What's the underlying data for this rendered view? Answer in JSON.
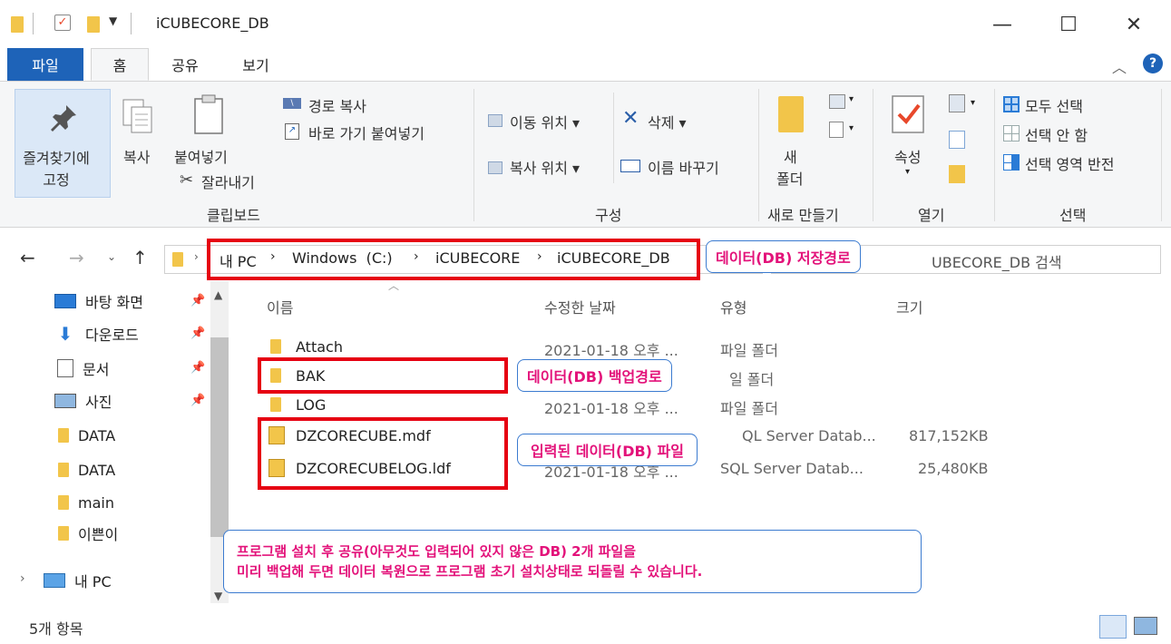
{
  "window": {
    "title": "iCUBECORE_DB",
    "minimize": "—",
    "maximize": "☐",
    "close": "✕"
  },
  "tabs": {
    "file": "파일",
    "home": "홈",
    "share": "공유",
    "view": "보기"
  },
  "ribbon": {
    "pin_line1": "즐겨찾기에",
    "pin_line2": "고정",
    "copy": "복사",
    "paste": "붙여넣기",
    "copy_path": "경로 복사",
    "paste_shortcut": "바로 가기 붙여넣기",
    "cut": "잘라내기",
    "group_clipboard": "클립보드",
    "move_to": "이동 위치 ▾",
    "copy_to": "복사 위치 ▾",
    "delete": "삭제 ▾",
    "rename": "이름 바꾸기",
    "group_organize": "구성",
    "new_folder_line1": "새",
    "new_folder_line2": "폴더",
    "group_new": "새로 만들기",
    "properties": "속성",
    "group_open": "열기",
    "select_all": "모두 선택",
    "select_none": "선택 안 함",
    "invert_selection": "선택 영역 반전",
    "group_select": "선택"
  },
  "address": {
    "crumbs": [
      "내 PC",
      "Windows  (C:)",
      "iCUBECORE",
      "iCUBECORE_DB"
    ],
    "search_placeholder": "iCUBECORE_DB 검색",
    "search_visible": "UBECORE_DB 검색"
  },
  "sidebar": {
    "items": [
      {
        "label": "바탕 화면",
        "pinned": true
      },
      {
        "label": "다운로드",
        "pinned": true
      },
      {
        "label": "문서",
        "pinned": true
      },
      {
        "label": "사진",
        "pinned": true
      },
      {
        "label": "DATA"
      },
      {
        "label": "DATA"
      },
      {
        "label": "main"
      },
      {
        "label": "이쁜이"
      },
      {
        "label": "내 PC"
      }
    ]
  },
  "columns": {
    "name": "이름",
    "modified": "수정한 날짜",
    "type": "유형",
    "size": "크기"
  },
  "files": [
    {
      "name": "Attach",
      "modified": "2021-01-18 오후 ...",
      "type": "파일 폴더",
      "size": ""
    },
    {
      "name": "BAK",
      "modified": "",
      "type": "일 폴더",
      "size": ""
    },
    {
      "name": "LOG",
      "modified": "2021-01-18 오후 ...",
      "type": "파일 폴더",
      "size": ""
    },
    {
      "name": "DZCORECUBE.mdf",
      "modified": "",
      "type": "QL Server Datab...",
      "size": "817,152KB"
    },
    {
      "name": "DZCORECUBELOG.ldf",
      "modified": "2021-01-18 오후 ...",
      "type": "SQL Server Datab...",
      "size": "25,480KB"
    }
  ],
  "status": {
    "count": "5개 항목"
  },
  "annotations": {
    "storage_path": "데이터(DB) 저장경로",
    "backup_path": "데이터(DB) 백업경로",
    "data_files": "입력된 데이터(DB) 파일",
    "note_line1": "프로그램 설치 후 공유(아무것도 입력되어 있지 않은 DB) 2개 파일을",
    "note_line2": "미리 백업해 두면 데이터 복원으로 프로그램 초기 설치상태로 되돌릴 수 있습니다."
  },
  "colors": {
    "accent": "#1e63b8",
    "annotation_red": "#e60012",
    "annotation_text": "#e3127a",
    "folder": "#f2c54a"
  }
}
